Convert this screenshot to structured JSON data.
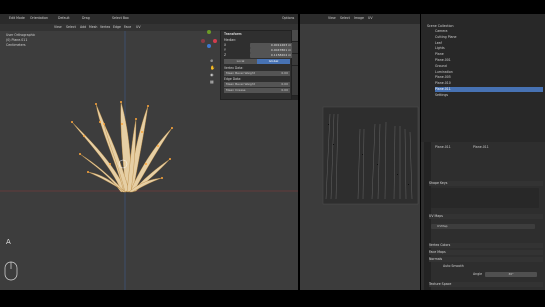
{
  "app": {
    "editor_mode": "Edit Mode",
    "header_menus": [
      "Orientation",
      "Default",
      "Drag",
      "Select Box"
    ],
    "view_menus": [
      "View",
      "Select",
      "Add",
      "Mesh",
      "Vertex",
      "Edge",
      "Face",
      "UV"
    ],
    "options_label": "Options"
  },
  "viewport": {
    "info_lines": [
      "User Orthographic",
      "(0) Plane.011",
      "Centimeters"
    ],
    "key_overlay": "A"
  },
  "npanel": {
    "title": "Transform",
    "median_label": "Median:",
    "axes": [
      {
        "axis": "X",
        "value": "0.0011263 m"
      },
      {
        "axis": "Y",
        "value": "0.0047861 m"
      },
      {
        "axis": "Z",
        "value": "0.1158204 m"
      }
    ],
    "local_label": "Local",
    "global_label": "Global",
    "vertex_data_label": "Vertex Data:",
    "mean_bevel_weight_label": "Mean Bevel Weight",
    "mean_bevel_weight_value": "0.00",
    "edge_data_label": "Edge Data:",
    "mean_bevel_weight2_label": "Mean Bevel Weight",
    "mean_bevel_weight2_value": "0.00",
    "mean_crease_label": "Mean Crease",
    "mean_crease_value": "0.00",
    "tabs": [
      "Item",
      "Tool",
      "View",
      "Screencast Keys"
    ]
  },
  "uv_editor": {
    "menus": [
      "View",
      "Select",
      "Image",
      "UV"
    ]
  },
  "outliner": {
    "title": "Scene Collection",
    "items": [
      "Camera",
      "Cutting Plane",
      "Leaf",
      "Lights",
      "Plane",
      "Plane.001",
      "Ground",
      "Lumination",
      "Plane.005",
      "Plane.010",
      "Plane.011",
      "Settings"
    ],
    "selected_index": 10
  },
  "properties": {
    "object_name": "Plane.011",
    "data_name": "Plane.011",
    "shape_keys_label": "Shape Keys",
    "uv_maps_label": "UV Maps",
    "uv_map_name": "UVMap",
    "vertex_colors_label": "Vertex Colors",
    "face_maps_label": "Face Maps",
    "normals_label": "Normals",
    "auto_smooth_label": "Auto Smooth",
    "angle_label": "Angle",
    "angle_value": "30°",
    "texture_space_label": "Texture Space"
  },
  "colors": {
    "accent_blue": "#4772b3",
    "selected_orange": "#ffa63a",
    "x_axis": "#d23c4e",
    "y_axis": "#6d9b26",
    "z_axis": "#3f78cf"
  }
}
